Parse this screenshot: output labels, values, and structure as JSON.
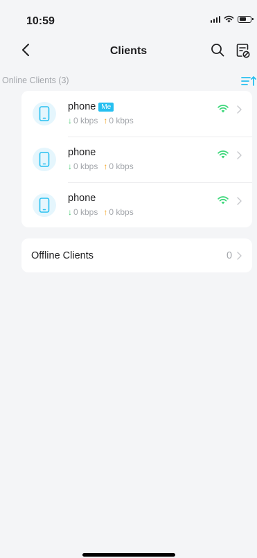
{
  "status_bar": {
    "time": "10:59"
  },
  "nav": {
    "title": "Clients"
  },
  "online_section": {
    "title": "Online Clients (3)"
  },
  "clients": [
    {
      "name": "phone",
      "badge": "Me",
      "download": "0 kbps",
      "upload": "0 kbps"
    },
    {
      "name": "phone",
      "download": "0 kbps",
      "upload": "0 kbps"
    },
    {
      "name": "phone",
      "download": "0 kbps",
      "upload": "0 kbps"
    }
  ],
  "offline": {
    "label": "Offline Clients",
    "count": "0"
  },
  "colors": {
    "accent": "#26bff0",
    "wifi": "#3cd77a",
    "download_arrow": "#4ccb77",
    "upload_arrow": "#f5a524",
    "background": "#f4f5f7"
  },
  "icons": [
    "chevron-left-icon",
    "search-icon",
    "blocklist-icon",
    "sort-icon",
    "phone-icon",
    "wifi-icon",
    "chevron-right-icon",
    "arrow-down-icon",
    "arrow-up-icon"
  ]
}
